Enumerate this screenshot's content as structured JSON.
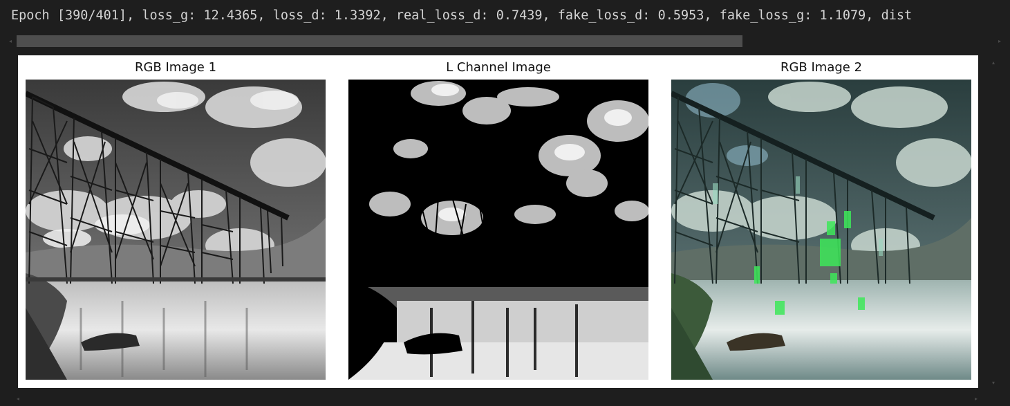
{
  "output": {
    "log_line": "Epoch [390/401], loss_g: 12.4365, loss_d: 1.3392, real_loss_d: 0.7439, fake_loss_d: 0.5953, fake_loss_g: 1.1079, dist"
  },
  "figure": {
    "panels": [
      {
        "title": "RGB Image 1",
        "image": "grayscale photo of a railway trestle bridge over a river under a cloudy sky"
      },
      {
        "title": "L Channel Image",
        "image": "high-contrast black L channel of the same bridge scene"
      },
      {
        "title": "RGB Image 2",
        "image": "colorized version of the bridge scene with green artifacts"
      }
    ]
  },
  "scrollbars": {
    "horizontal_thumb_fraction": 0.745
  },
  "colors": {
    "background": "#1e1e1e",
    "text": "#d4d4d4",
    "scroll_thumb": "#4e4e4e",
    "figure_bg": "#ffffff"
  }
}
